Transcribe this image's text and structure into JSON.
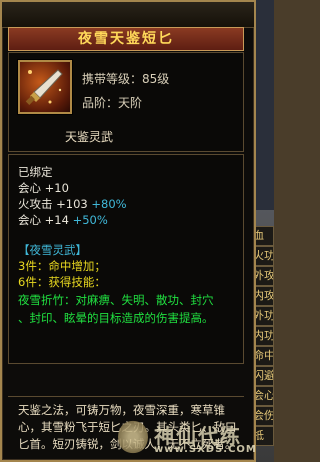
{
  "side_panel": {
    "rows": [
      "血",
      "火功",
      "外攻",
      "内攻",
      "外功",
      "内功",
      "命中",
      "闪避",
      "会心",
      "会伤",
      "抵"
    ]
  },
  "item": {
    "name": "夜雪天鉴短匕",
    "level_line": "携带等级：85级",
    "grade_line": "品阶：天阶",
    "subtitle": "天鉴灵武",
    "bound": "已绑定",
    "stats": [
      {
        "label": "会心 ",
        "base": "+10",
        "bonus": ""
      },
      {
        "label": "火攻击 ",
        "base": "+103",
        "bonus": "+80%"
      },
      {
        "label": "会心 ",
        "base": "+14",
        "bonus": "+50%"
      }
    ],
    "set_title": "【夜雪灵武】",
    "set_3": "3件：命中增加；",
    "set_6": "6件：获得技能：",
    "skill_line1": "夜雪折竹：对麻痹、失明、散功、封穴",
    "skill_line2": "、封印、眩晕的目标造成的伤害提高。",
    "description": "天鉴之法，可铸万物，夜雪深重，寒草锥心，其雪粉飞于短匕之刃。其头类匕、敌曰匕首。短刃铸锐，剑以诚人，无不立死者。"
  },
  "watermark": {
    "brand": "神仙代练",
    "url": "www.SXDS.COM"
  }
}
